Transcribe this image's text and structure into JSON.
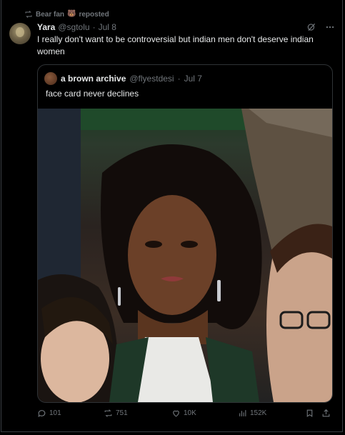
{
  "repost": {
    "user": "Bear fan",
    "emoji": "🐻",
    "label": "reposted",
    "icon": "repost-icon"
  },
  "post": {
    "name": "Yara",
    "handle": "@sgtolu",
    "dot": "·",
    "date": "Jul 8",
    "text": "I really don't want to be controversial but indian men don't deserve indian women"
  },
  "quote": {
    "name": "a brown archive",
    "handle": "@flyestdesi",
    "dot": "·",
    "date": "Jul 7",
    "text": "face card never declines"
  },
  "actions": {
    "replies": "101",
    "reposts": "751",
    "likes": "10K",
    "views": "152K"
  },
  "colors": {
    "background": "#000000",
    "text": "#e7e9ea",
    "muted": "#71767b",
    "border": "#2f3336"
  }
}
